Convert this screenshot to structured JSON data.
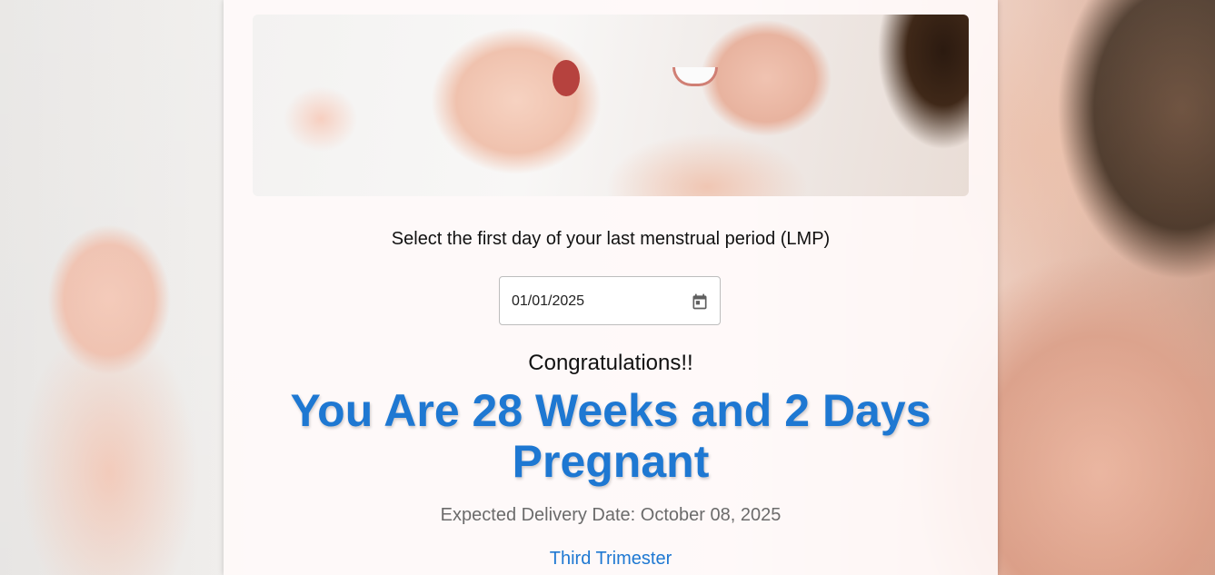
{
  "calculator": {
    "prompt": "Select the first day of your last menstrual period (LMP)",
    "lmp_date": "01/01/2025",
    "congrats": "Congratulations!!",
    "result_line1": "You Are 28 Weeks and 2 Days",
    "result_line2": "Pregnant",
    "due_date_text": "Expected Delivery Date: October 08, 2025",
    "trimester": "Third Trimester"
  },
  "colors": {
    "accent": "#1e78d2",
    "muted_text": "#6b6b6b"
  },
  "icons": {
    "date_picker": "calendar-icon"
  }
}
